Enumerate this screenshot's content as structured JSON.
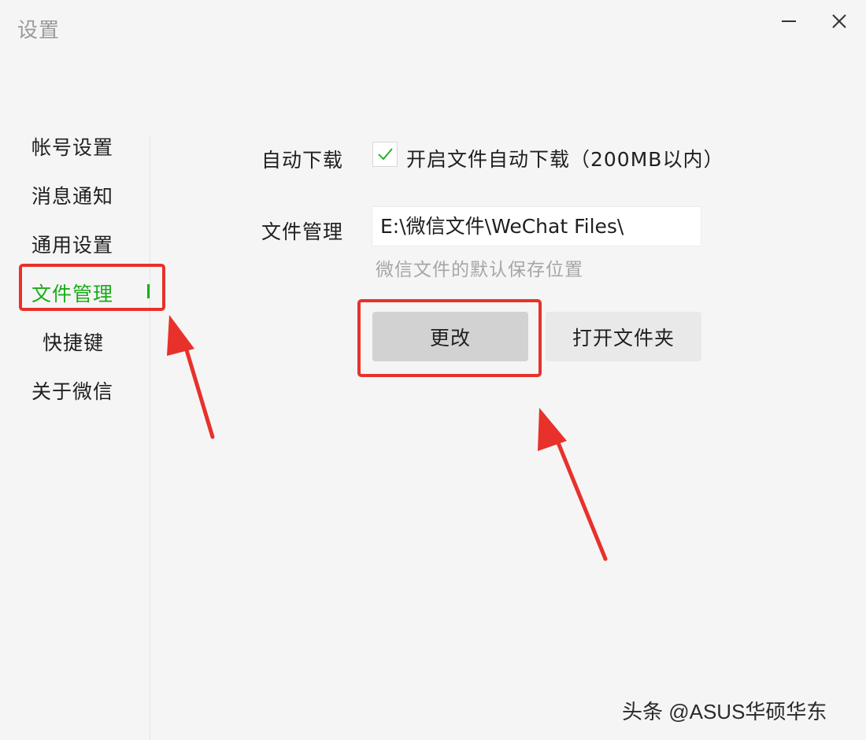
{
  "window": {
    "title": "设置"
  },
  "sidebar": {
    "items": [
      {
        "label": "帐号设置"
      },
      {
        "label": "消息通知"
      },
      {
        "label": "通用设置"
      },
      {
        "label": "文件管理",
        "active": true
      },
      {
        "label": "快捷键"
      },
      {
        "label": "关于微信"
      }
    ]
  },
  "main": {
    "auto_download": {
      "label": "自动下载",
      "checkbox_checked": true,
      "checkbox_label": "开启文件自动下载（200MB以内）"
    },
    "file_management": {
      "label": "文件管理",
      "path_value": "E:\\微信文件\\WeChat Files\\",
      "hint": "微信文件的默认保存位置",
      "change_button": "更改",
      "open_folder_button": "打开文件夹"
    }
  },
  "watermark": "头条 @ASUS华硕华东",
  "colors": {
    "accent": "#1aad19",
    "annotation": "#e8312b",
    "background": "#f5f5f5"
  },
  "icons": [
    "minimize-icon",
    "close-icon",
    "checkmark-icon"
  ]
}
